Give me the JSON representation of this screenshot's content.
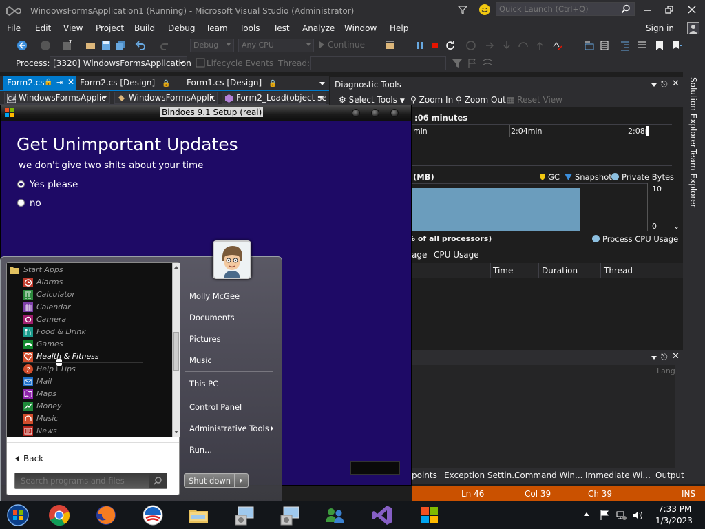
{
  "vs": {
    "title": "WindowsFormsApplication1 (Running) - Microsoft Visual Studio (Administrator)",
    "quick_launch_placeholder": "Quick Launch (Ctrl+Q)",
    "menu": [
      "File",
      "Edit",
      "View",
      "Project",
      "Build",
      "Debug",
      "Team",
      "Tools",
      "Test",
      "Analyze",
      "Window",
      "Help"
    ],
    "sign_in": "Sign in",
    "toolbar": {
      "config": "Debug",
      "platform": "Any CPU",
      "continue": "Continue"
    },
    "process_label": "Process:",
    "process_value": "[3320] WindowsFormsApplication",
    "lifecycle_label": "Lifecycle Events",
    "thread_label": "Thread:",
    "doc_tabs": [
      "Form2.cs",
      "Form2.cs [Design]",
      "Form1.cs [Design]"
    ],
    "nav": {
      "project": "WindowsFormsApplic",
      "type": "WindowsFormsApplic",
      "member": "Form2_Load(object se"
    },
    "colors": {
      "accent": "#007acc",
      "status": "#ca5100",
      "chrome": "#2d2d30"
    }
  },
  "diag": {
    "title": "Diagnostic Tools",
    "select_tools": "Select Tools",
    "zoom_in": "Zoom In",
    "zoom_out": "Zoom Out",
    "reset_view": "Reset View",
    "session": ":06 minutes",
    "ticks": [
      "min",
      "2:04min",
      "2:08n"
    ],
    "memory_title": "(MB)",
    "legend": {
      "gc": "GC",
      "snapshot": "Snapshot",
      "private_bytes": "Private Bytes"
    },
    "mem_axis": {
      "max": "10",
      "min": "0"
    },
    "cpu_title": "% of all processors)",
    "cpu_legend": "Process CPU Usage",
    "tabs": [
      "age",
      "CPU Usage"
    ],
    "columns": [
      "Time",
      "Duration",
      "Thread"
    ]
  },
  "bottom_pane": {
    "lang_label": "Lang",
    "tabs": [
      "points",
      "Exception Settin...",
      "Command Win...",
      "Immediate Wi...",
      "Output"
    ]
  },
  "status_bar": {
    "ln": "Ln 46",
    "col": "Col 39",
    "ch": "Ch 39",
    "mode": "INS"
  },
  "side_tabs": [
    "Solution Explorer",
    "Team Explorer"
  ],
  "setup": {
    "title": "Bindoes 9.1 Setup (real)",
    "heading": "Get Unimportant Updates",
    "subtitle": "we don't give two shits about your time",
    "options": [
      {
        "label": "Yes please",
        "checked": true
      },
      {
        "label": "no",
        "checked": false
      }
    ]
  },
  "start_menu": {
    "folder": "Start Apps",
    "apps": [
      "Alarms",
      "Calculator",
      "Calendar",
      "Camera",
      "Food & Drink",
      "Games",
      "Health & Fitness",
      "Help+Tips",
      "Mail",
      "Maps",
      "Money",
      "Music",
      "News"
    ],
    "hovered_app": "Health & Fitness",
    "back": "Back",
    "search_placeholder": "Search programs and files",
    "right_items": {
      "user": "Molly McGee",
      "documents": "Documents",
      "pictures": "Pictures",
      "music": "Music",
      "this_pc": "This PC",
      "control_panel": "Control Panel",
      "admin_tools": "Administrative Tools",
      "run": "Run..."
    },
    "shutdown": "Shut down"
  },
  "taskbar": {
    "apps": [
      "start-button-icon",
      "chrome-icon",
      "firefox-icon",
      "obama-icon",
      "file-explorer-icon",
      "setup-installer-icon",
      "setup-installer-icon-2",
      "network-users-icon",
      "visual-studio-icon",
      "windows-flag-icon"
    ],
    "time": "7:33 PM",
    "date": "1/3/2023"
  }
}
